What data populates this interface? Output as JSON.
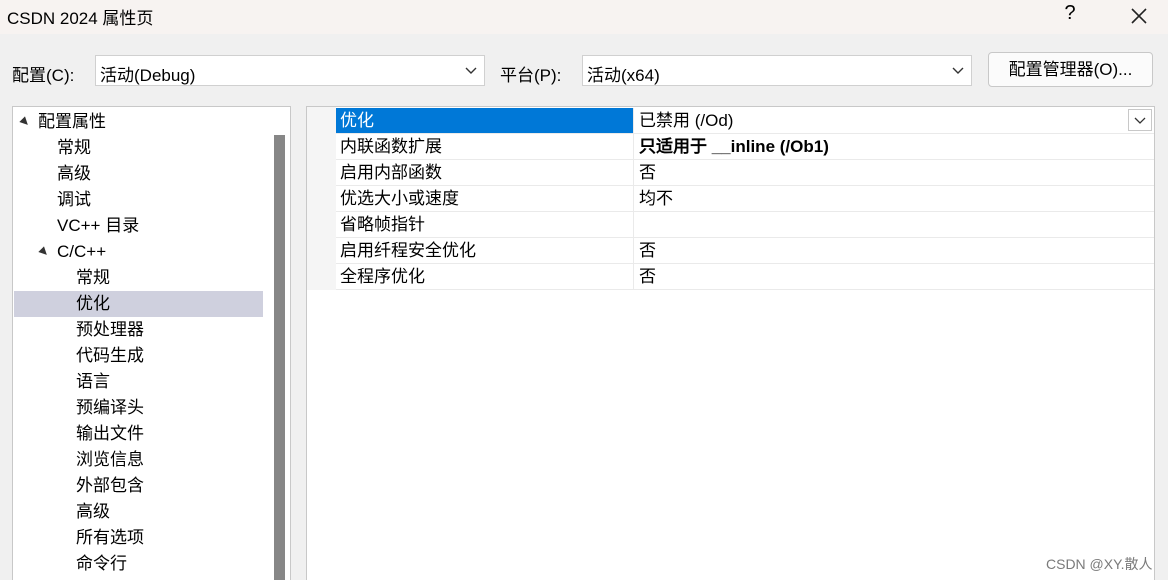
{
  "window": {
    "title": "CSDN 2024 属性页",
    "help_label": "?"
  },
  "config": {
    "config_label": "配置(C):",
    "config_value": "活动(Debug)",
    "platform_label": "平台(P):",
    "platform_value": "活动(x64)",
    "manager_button": "配置管理器(O)..."
  },
  "tree": {
    "root": "配置属性",
    "items": [
      "常规",
      "高级",
      "调试",
      "VC++ 目录"
    ],
    "cpp_group": "C/C++",
    "cpp_items": [
      "常规",
      "优化",
      "预处理器",
      "代码生成",
      "语言",
      "预编译头",
      "输出文件",
      "浏览信息",
      "外部包含",
      "高级",
      "所有选项",
      "命令行"
    ],
    "selected": "优化"
  },
  "grid": {
    "rows": [
      {
        "name": "优化",
        "value": "已禁用 (/Od)"
      },
      {
        "name": "内联函数扩展",
        "value": "只适用于 __inline (/Ob1)"
      },
      {
        "name": "启用内部函数",
        "value": "否"
      },
      {
        "name": "优选大小或速度",
        "value": "均不"
      },
      {
        "name": "省略帧指针",
        "value": ""
      },
      {
        "name": "启用纤程安全优化",
        "value": "否"
      },
      {
        "name": "全程序优化",
        "value": "否"
      }
    ]
  },
  "watermark": "CSDN @XY.散人",
  "colors": {
    "selection_blue": "#0078d7",
    "tree_selection": "#cfd0de",
    "title_bar": "#f7f3f1"
  }
}
